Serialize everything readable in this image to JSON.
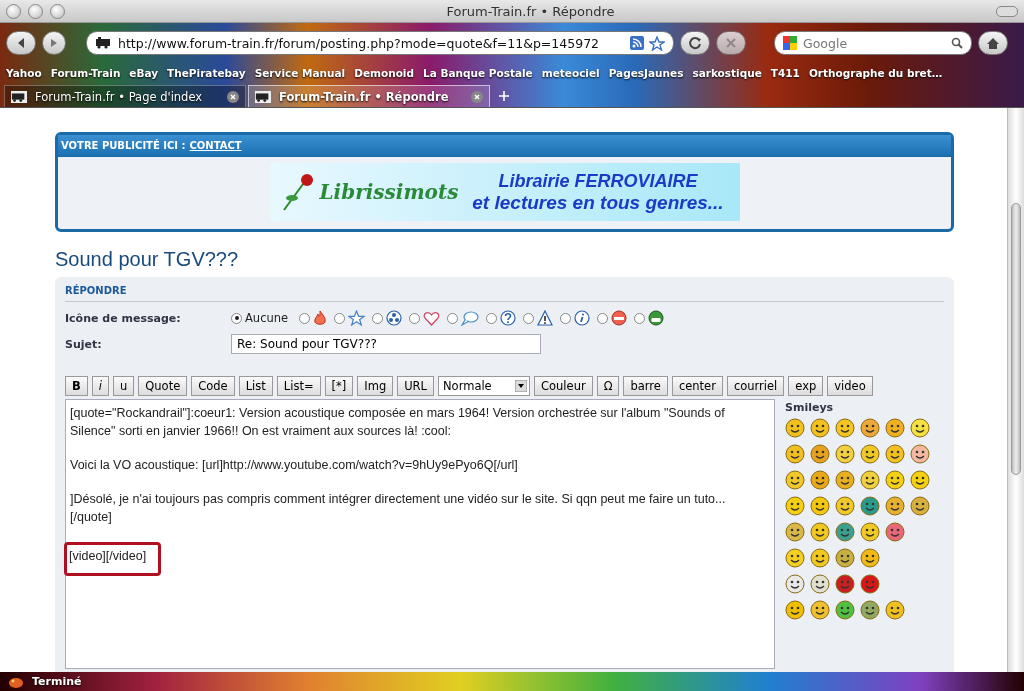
{
  "window": {
    "title": "Forum-Train.fr • Répondre"
  },
  "toolbar": {
    "url": "http://www.forum-train.fr/forum/posting.php?mode=quote&f=11&p=145972",
    "search_placeholder": "Google"
  },
  "bookmarks": [
    "Yahoo",
    "Forum-Train",
    "eBay",
    "ThePiratebay",
    "Service Manual",
    "Demonoid",
    "La Banque Postale",
    "meteociel",
    "PagesJaunes",
    "sarkostique",
    "T411",
    "Orthographe du bret…"
  ],
  "tabs": [
    {
      "label": "Forum-Train.fr • Page d'index",
      "selected": false
    },
    {
      "label": "Forum-Train.fr • Répondre",
      "selected": true
    }
  ],
  "ad": {
    "label": "VOTRE PUBLICITÉ ICI :",
    "link": "CONTACT",
    "banner_logo": "Librissimots",
    "banner_line_1": "Librairie FERROVIAIRE",
    "banner_line_2": "et lectures en tous genres..."
  },
  "topic_title": "Sound pour TGV???",
  "form": {
    "section": "RÉPONDRE",
    "icon_label": "Icône de message:",
    "icons": [
      {
        "kind": "none",
        "label": "Aucune",
        "selected": true
      },
      {
        "kind": "fire",
        "selected": false
      },
      {
        "kind": "star",
        "selected": false
      },
      {
        "kind": "radioactive",
        "selected": false
      },
      {
        "kind": "heart",
        "selected": false
      },
      {
        "kind": "speech",
        "selected": false
      },
      {
        "kind": "question",
        "selected": false
      },
      {
        "kind": "warning",
        "selected": false
      },
      {
        "kind": "info",
        "selected": false
      },
      {
        "kind": "redface",
        "selected": false
      },
      {
        "kind": "grin",
        "selected": false
      }
    ],
    "subject_label": "Sujet:",
    "subject_value": "Re: Sound pour TGV???",
    "format_buttons": [
      {
        "kind": "button",
        "label": "B"
      },
      {
        "kind": "button",
        "label": "i"
      },
      {
        "kind": "button",
        "label": "u"
      },
      {
        "kind": "button",
        "label": "Quote"
      },
      {
        "kind": "button",
        "label": "Code"
      },
      {
        "kind": "button",
        "label": "List"
      },
      {
        "kind": "button",
        "label": "List="
      },
      {
        "kind": "button",
        "label": "[*]"
      },
      {
        "kind": "button",
        "label": "Img"
      },
      {
        "kind": "button",
        "label": "URL"
      },
      {
        "kind": "select",
        "label": "Normale"
      },
      {
        "kind": "button",
        "label": "Couleur"
      },
      {
        "kind": "button",
        "label": "Ω"
      },
      {
        "kind": "button",
        "label": "barre"
      },
      {
        "kind": "button",
        "label": "center"
      },
      {
        "kind": "button",
        "label": "courriel"
      },
      {
        "kind": "button",
        "label": "exp"
      },
      {
        "kind": "button",
        "label": "video"
      }
    ],
    "message": [
      {
        "text": "[quote=\"Rockandrail\"]:coeur1:  Version acoustique composée en mars 1964! Version orchestrée sur l'album \"Sounds of Silence\" sorti en janvier 1966!! On est vraiment aux sources là! :cool:",
        "highlighted": false
      },
      {
        "text": "Voici la VO acoustique: [url]http://www.youtube.com/watch?v=9hUy9ePyo6Q[/url]",
        "highlighted": false
      },
      {
        "text": "]Désolé, je n'ai toujours pas compris comment intégrer directement une vidéo sur le site. Si qqn peut me faire un tuto...[/quote]",
        "highlighted": false
      },
      {
        "text": "[video][/video]",
        "highlighted": true
      }
    ],
    "smileys_title": "Smileys",
    "smileys": [
      [
        {
          "color": "#f2c21a"
        },
        {
          "color": "#f0c020"
        },
        {
          "color": "#f3c624"
        },
        {
          "color": "#eea83a"
        },
        {
          "color": "#f0b020"
        },
        {
          "color": "#f4e040"
        }
      ],
      [
        {
          "color": "#f0c020"
        },
        {
          "color": "#e8a020"
        },
        {
          "color": "#f2d040"
        },
        {
          "color": "#f0c828"
        },
        {
          "color": "#f2c020"
        },
        {
          "color": "#f4b8a0"
        }
      ],
      [
        {
          "color": "#f0c828"
        },
        {
          "color": "#e8a818"
        },
        {
          "color": "#e8b020"
        },
        {
          "color": "#f0d040"
        },
        {
          "color": "#f4d010"
        },
        {
          "color": "#f4d010"
        }
      ],
      [
        {
          "color": "#f4d010"
        },
        {
          "color": "#f4c810"
        },
        {
          "color": "#f0c828"
        },
        {
          "color": "#2a9a8a"
        },
        {
          "color": "#e8b030"
        },
        {
          "color": "#d8b040"
        }
      ],
      [
        {
          "color": "#d8b848"
        },
        {
          "color": "#f0c820"
        },
        {
          "color": "#3aa090"
        },
        {
          "color": "#f0c828"
        },
        {
          "color": "#e86878"
        }
      ],
      [
        {
          "color": "#f4d020"
        },
        {
          "color": "#f0c820"
        },
        {
          "color": "#c8b040"
        },
        {
          "color": "#f0b818"
        }
      ],
      [
        {
          "color": "#e8e8e8"
        },
        {
          "color": "#e0e0d0"
        },
        {
          "color": "#c82020"
        },
        {
          "color": "#d81818"
        }
      ],
      [
        {
          "color": "#f0c000"
        },
        {
          "color": "#f0c030"
        },
        {
          "color": "#50c040"
        },
        {
          "color": "#90a860"
        },
        {
          "color": "#f0c020"
        }
      ]
    ]
  },
  "status": "Terminé"
}
